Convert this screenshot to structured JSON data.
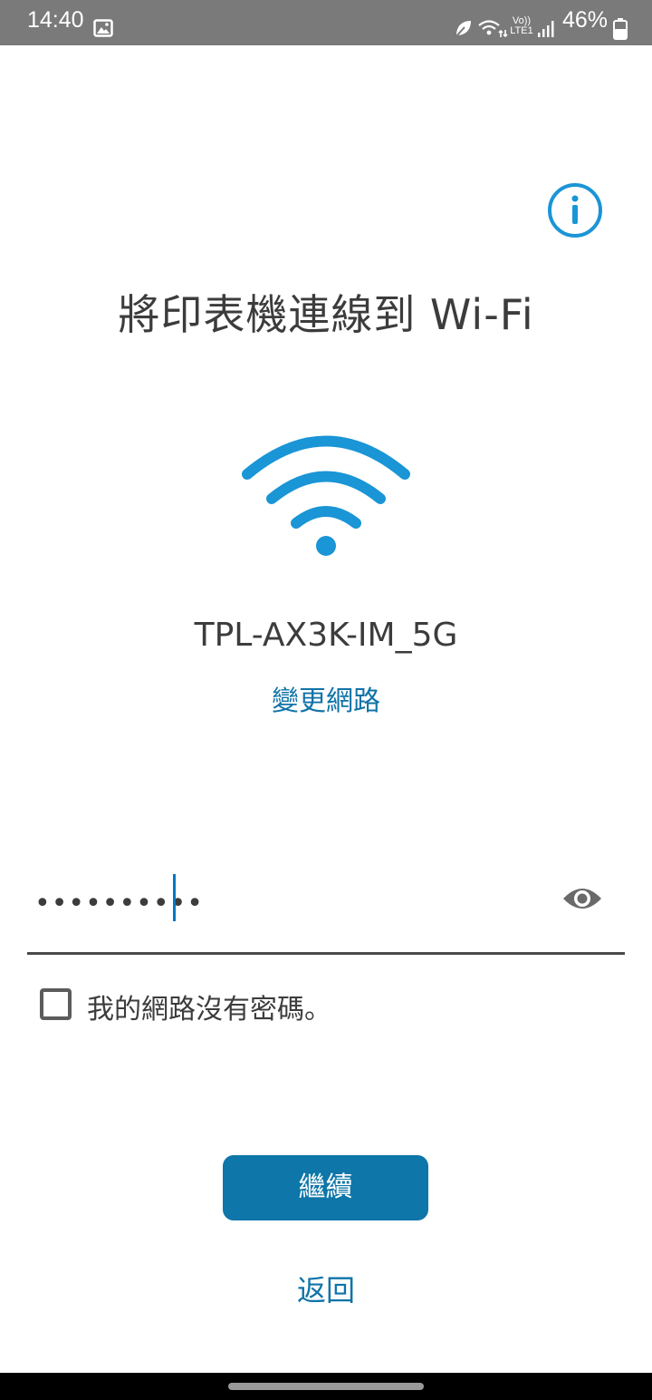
{
  "status_bar": {
    "time": "14:40",
    "battery_percent": "46%",
    "volte_line1": "Vo))",
    "volte_line2": "LTE1",
    "icons": [
      "gallery-icon",
      "leaf-icon",
      "wifi6-icon",
      "volte-icon",
      "signal-icon",
      "battery-icon"
    ]
  },
  "page": {
    "title": "將印表機連線到 Wi-Fi",
    "network_name": "TPL-AX3K-IM_5G",
    "change_network_label": "變更網路"
  },
  "password": {
    "masked_value": "••••••••••",
    "show_password_icon": "eye-icon"
  },
  "no_password": {
    "label": "我的網路沒有密碼。",
    "checked": false
  },
  "actions": {
    "continue_label": "繼續",
    "back_label": "返回"
  },
  "colors": {
    "accent": "#0e76a8",
    "link": "#1073a8",
    "wifi_icon": "#1a95d6",
    "status_bar": "#7a7a7a"
  }
}
